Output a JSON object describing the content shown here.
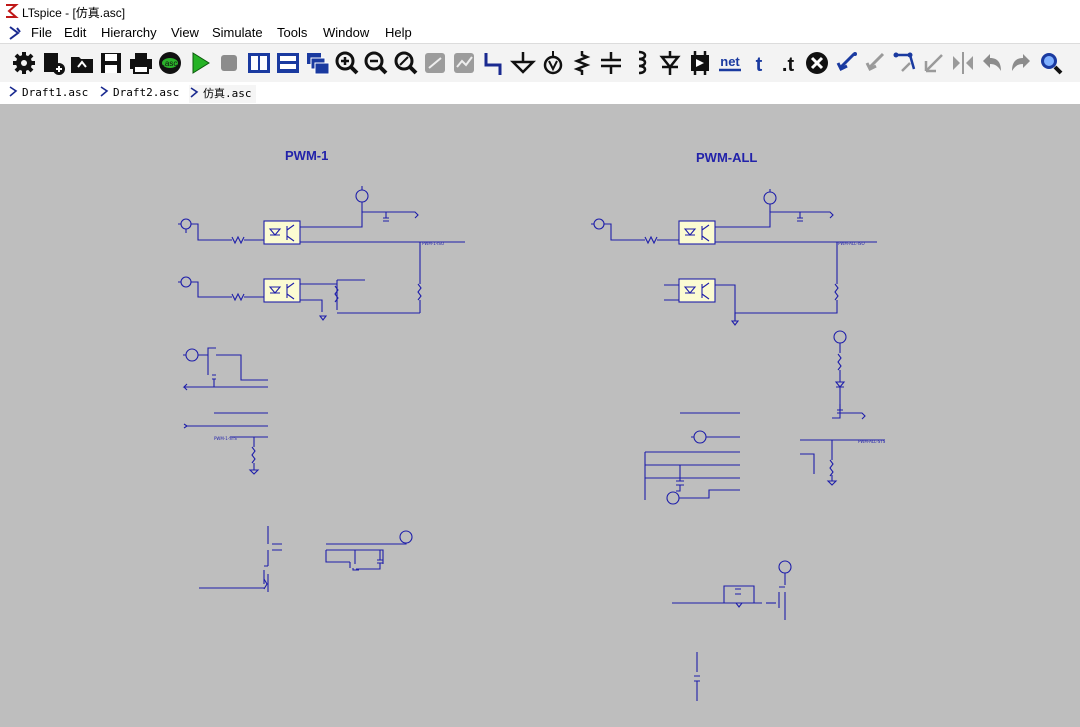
{
  "window": {
    "title": "LTspice - [仿真.asc]"
  },
  "menu": {
    "items": [
      "File",
      "Edit",
      "Hierarchy",
      "View",
      "Simulate",
      "Tools",
      "Window",
      "Help"
    ]
  },
  "toolbar": {
    "icons": [
      "control-panel-icon",
      "new-schematic-icon",
      "open-icon",
      "save-icon",
      "print-icon",
      "asc-setup-icon",
      "run-icon",
      "halt-icon",
      "tile-vertical-icon",
      "tile-horizontal-icon",
      "cascade-icon",
      "zoom-in-icon",
      "zoom-out-icon",
      "zoom-fit-icon",
      "autoscale-icon",
      "waveform-icon",
      "wire-icon",
      "ground-icon",
      "label-icon",
      "resistor-icon",
      "capacitor-icon",
      "inductor-icon",
      "diode-icon",
      "component-icon",
      "net-label-icon",
      "text-icon",
      "spice-directive-icon",
      "delete-icon",
      "copy-icon",
      "move-icon",
      "drag-icon",
      "rotate-icon",
      "mirror-icon",
      "undo-icon",
      "redo-icon",
      "find-icon"
    ],
    "net_label": "net",
    "text_label": "t",
    "directive_label": ".t"
  },
  "tabs": [
    {
      "label": "Draft1.asc"
    },
    {
      "label": "Draft2.asc"
    },
    {
      "label": "仿真.asc",
      "active": true
    }
  ],
  "schematic": {
    "left_title": "PWM-1",
    "right_title": "PWM-ALL",
    "colors": {
      "wire": "#1e1eaa",
      "component": "#1e1e8c",
      "optocoupler_fill": "#fbfbd2",
      "title": "#2222aa",
      "canvas": "#bebebe"
    },
    "net_labels": {
      "pwm1_iso": "PWM-1-ISO",
      "pwm1_sts": "PWM-1-STS",
      "pwmall_iso": "PWM-ALL-ISO",
      "pwmall_sts": "PWM-ALL-STS"
    }
  }
}
